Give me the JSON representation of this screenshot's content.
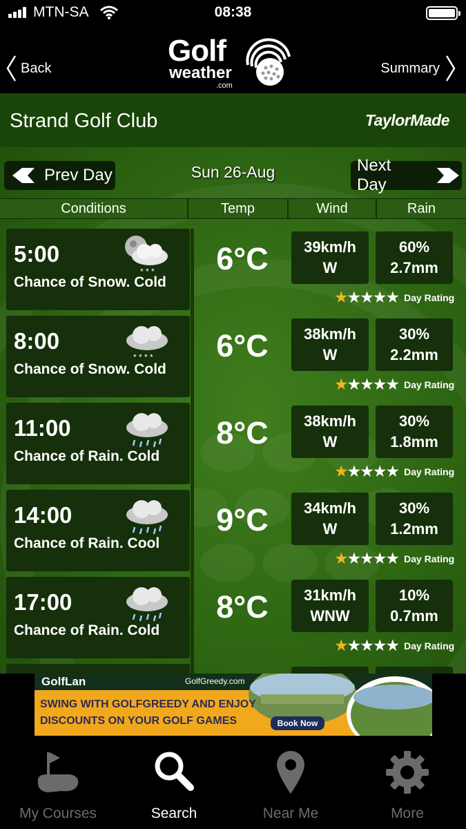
{
  "status_bar": {
    "carrier": "MTN-SA",
    "time": "08:38"
  },
  "nav": {
    "back_label": "Back",
    "summary_label": "Summary",
    "logo": {
      "line1": "Golf",
      "line2": "weather",
      "line3": ".com"
    }
  },
  "club": {
    "name": "Strand Golf Club",
    "sponsor": "TaylorMade"
  },
  "day_nav": {
    "prev_label": "Prev Day",
    "date": "Sun 26-Aug",
    "next_label": "Next Day"
  },
  "columns": [
    "Conditions",
    "Temp",
    "Wind",
    "Rain"
  ],
  "forecast": [
    {
      "time": "5:00",
      "conditions": "Chance of Snow. Cold",
      "icon": "moon-snow-cloud-icon",
      "temp": "6°C",
      "wind_speed": "39km/h",
      "wind_dir": "W",
      "rain_chance": "60%",
      "rain_amount": "2.7mm",
      "rating_stars": 1,
      "rating_label": "Day Rating"
    },
    {
      "time": "8:00",
      "conditions": "Chance of Snow. Cold",
      "icon": "snow-cloud-icon",
      "temp": "6°C",
      "wind_speed": "38km/h",
      "wind_dir": "W",
      "rain_chance": "30%",
      "rain_amount": "2.2mm",
      "rating_stars": 1,
      "rating_label": "Day Rating"
    },
    {
      "time": "11:00",
      "conditions": "Chance of Rain. Cold",
      "icon": "rain-cloud-icon",
      "temp": "8°C",
      "wind_speed": "38km/h",
      "wind_dir": "W",
      "rain_chance": "30%",
      "rain_amount": "1.8mm",
      "rating_stars": 1,
      "rating_label": "Day Rating"
    },
    {
      "time": "14:00",
      "conditions": "Chance of Rain. Cool",
      "icon": "rain-cloud-icon",
      "temp": "9°C",
      "wind_speed": "34km/h",
      "wind_dir": "W",
      "rain_chance": "30%",
      "rain_amount": "1.2mm",
      "rating_stars": 1,
      "rating_label": "Day Rating"
    },
    {
      "time": "17:00",
      "conditions": "Chance of Rain. Cold",
      "icon": "rain-cloud-icon",
      "temp": "8°C",
      "wind_speed": "31km/h",
      "wind_dir": "WNW",
      "rain_chance": "10%",
      "rain_amount": "0.7mm",
      "rating_stars": 1,
      "rating_label": "Day Rating"
    }
  ],
  "ad": {
    "brand": "GolfLan",
    "partner": "GolfGreedy.com",
    "line1": "SWING WITH GOLFGREEDY AND ENJOY",
    "line2": "DISCOUNTS ON YOUR GOLF GAMES",
    "button": "Book Now"
  },
  "tabs": [
    {
      "label": "My Courses",
      "icon": "course-flag-icon"
    },
    {
      "label": "Search",
      "icon": "search-icon"
    },
    {
      "label": "Near Me",
      "icon": "location-pin-icon"
    },
    {
      "label": "More",
      "icon": "gear-icon"
    }
  ],
  "colors": {
    "panel": "#15300a",
    "background_green": "#2d6512",
    "star": "#f2b61e",
    "ad": "#f2a81d"
  }
}
